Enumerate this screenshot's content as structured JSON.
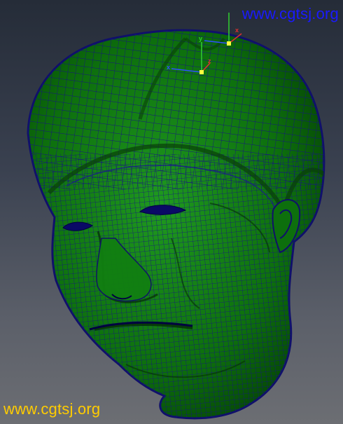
{
  "watermark": {
    "top_text": "www.cgtsj.org",
    "bottom_text": "www.cgtsj.org",
    "top_color": "#1a1aff",
    "bottom_color": "#ffcc00"
  },
  "viewport": {
    "object": "head-mesh",
    "mesh_color": "#0e7a0e",
    "wire_color": "#1a1a8c",
    "background_top": "#252c38",
    "background_bottom": "#6c6e73"
  },
  "manipulators": {
    "axis_labels": {
      "x": "x",
      "y": "y",
      "z": "z"
    },
    "colors": {
      "x": "#e03030",
      "y": "#30d030",
      "z": "#3050ff"
    }
  }
}
